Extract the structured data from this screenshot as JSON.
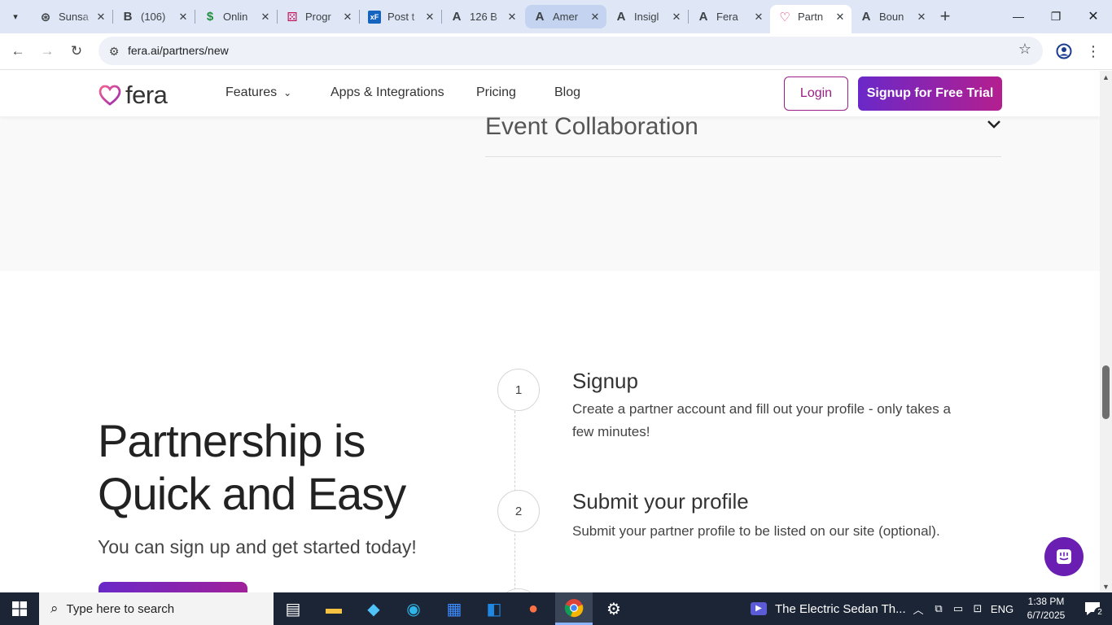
{
  "browser": {
    "tabs": [
      {
        "title": "Sunsa",
        "icon": "openai-icon",
        "glyph": "⊛"
      },
      {
        "title": "(106)",
        "icon": "b-icon",
        "glyph": "B"
      },
      {
        "title": "Onlin",
        "icon": "dollar-icon",
        "glyph": "$"
      },
      {
        "title": "Progr",
        "icon": "dice-icon",
        "glyph": "⚄"
      },
      {
        "title": "Post t",
        "icon": "xf-icon",
        "glyph": "xF"
      },
      {
        "title": "126 B",
        "icon": "a-icon",
        "glyph": "A"
      },
      {
        "title": "Amer",
        "icon": "a-icon",
        "glyph": "A"
      },
      {
        "title": "Insigl",
        "icon": "a-icon",
        "glyph": "A"
      },
      {
        "title": "Fera",
        "icon": "a-icon",
        "glyph": "A"
      },
      {
        "title": "Partn",
        "icon": "fera-heart-icon",
        "glyph": "♡"
      },
      {
        "title": "Boun",
        "icon": "a-icon",
        "glyph": "A"
      }
    ],
    "url": "fera.ai/partners/new"
  },
  "site": {
    "logo_text": "fera",
    "nav": {
      "features": "Features",
      "apps": "Apps & Integrations",
      "pricing": "Pricing",
      "blog": "Blog",
      "login": "Login",
      "signup": "Signup for Free Trial"
    },
    "faq": {
      "item_title": "Event Collaboration"
    },
    "partnership": {
      "heading": "Partnership is Quick and Easy",
      "subheading": "You can sign up and get started today!",
      "steps": [
        {
          "number": "1",
          "title": "Signup",
          "description": "Create a partner account and fill out your profile - only takes a few minutes!"
        },
        {
          "number": "2",
          "title": "Submit your profile",
          "description": "Submit your partner profile to be listed on our site (optional)."
        }
      ]
    },
    "colors": {
      "brand_purple": "#6a28c8",
      "brand_magenta": "#b41f8f",
      "login_border": "#9b1f86"
    }
  },
  "taskbar": {
    "search_placeholder": "Type here to search",
    "media_title": "The Electric Sedan Th...",
    "language": "ENG",
    "time": "1:38 PM",
    "date": "6/7/2025",
    "notifications": "2"
  }
}
